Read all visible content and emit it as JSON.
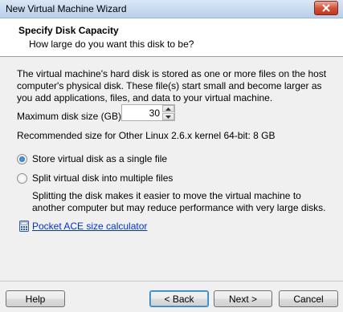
{
  "window": {
    "title": "New Virtual Machine Wizard"
  },
  "header": {
    "title": "Specify Disk Capacity",
    "subtitle": "How large do you want this disk to be?"
  },
  "content": {
    "description": "The virtual machine's hard disk is stored as one or more files on the host computer's physical disk. These file(s) start small and become larger as you add applications, files, and data to your virtual machine.",
    "max_size_label": "Maximum disk size (GB):",
    "max_size_value": "30",
    "recommended": "Recommended size for Other Linux 2.6.x kernel 64-bit: 8 GB",
    "options": [
      {
        "label": "Store virtual disk as a single file",
        "selected": true
      },
      {
        "label": "Split virtual disk into multiple files",
        "selected": false
      }
    ],
    "split_description": "Splitting the disk makes it easier to move the virtual machine to another computer but may reduce performance with very large disks.",
    "link_label": "Pocket ACE size calculator"
  },
  "footer": {
    "help": "Help",
    "back": "< Back",
    "next": "Next >",
    "cancel": "Cancel"
  }
}
